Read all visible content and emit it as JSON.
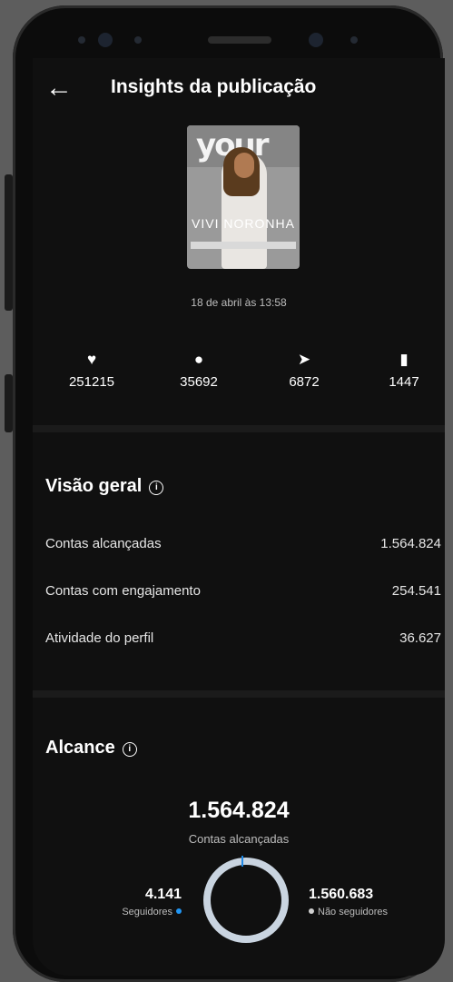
{
  "header": {
    "title": "Insights da publicação",
    "back_icon": "arrow-left-icon"
  },
  "post": {
    "thumbnail_logo": "your",
    "thumbnail_name": "VIVI NORONHA",
    "date": "18 de abril às 13:58"
  },
  "stats": [
    {
      "icon": "heart-icon",
      "value": "251215"
    },
    {
      "icon": "comment-icon",
      "value": "35692"
    },
    {
      "icon": "send-icon",
      "value": "6872"
    },
    {
      "icon": "bookmark-icon",
      "value": "1447"
    }
  ],
  "overview": {
    "title": "Visão geral",
    "rows": [
      {
        "label": "Contas alcançadas",
        "value": "1.564.824"
      },
      {
        "label": "Contas com engajamento",
        "value": "254.541"
      },
      {
        "label": "Atividade do perfil",
        "value": "36.627"
      }
    ]
  },
  "reach": {
    "title": "Alcance",
    "total": "1.564.824",
    "total_label": "Contas alcançadas",
    "followers_value": "4.141",
    "followers_label": "Seguidores",
    "nonfollowers_value": "1.560.683",
    "nonfollowers_label": "Não seguidores",
    "colors": {
      "followers": "#2196f3",
      "nonfollowers": "#c9d4e0"
    }
  }
}
